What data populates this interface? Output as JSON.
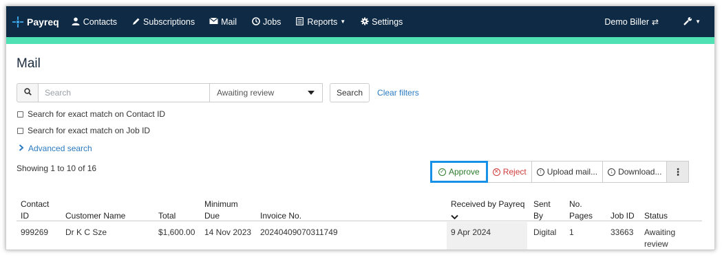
{
  "nav": {
    "brand": "Payreq",
    "items": [
      {
        "label": "Contacts",
        "icon": "user-icon"
      },
      {
        "label": "Subscriptions",
        "icon": "pencil-icon"
      },
      {
        "label": "Mail",
        "icon": "envelope-icon"
      },
      {
        "label": "Jobs",
        "icon": "clock-icon"
      },
      {
        "label": "Reports",
        "icon": "list-icon"
      },
      {
        "label": "Settings",
        "icon": "gear-icon"
      }
    ],
    "biller": "Demo Biller"
  },
  "colors": {
    "navbar": "#0e2a45",
    "accent": "#4fe0b3",
    "link": "#2a7ac0",
    "highlight": "#1791e8"
  },
  "page": {
    "title": "Mail"
  },
  "filters": {
    "search_placeholder": "Search",
    "status_selected": "Awaiting review",
    "search_button": "Search",
    "clear_filters": "Clear filters",
    "exact_contact": "Search for exact match on Contact ID",
    "exact_job": "Search for exact match on Job ID",
    "advanced_search": "Advanced search"
  },
  "summary": {
    "showing": "Showing 1 to 10 of 16"
  },
  "actions": {
    "approve": "Approve",
    "reject": "Reject",
    "upload": "Upload mail...",
    "download": "Download..."
  },
  "table": {
    "headers": {
      "contact_id": [
        "Contact",
        "ID"
      ],
      "customer_name": "Customer Name",
      "total": "Total",
      "minimum_due": [
        "Minimum",
        "Due"
      ],
      "invoice_no": "Invoice No.",
      "received_by": "Received by Payreq",
      "sent_by": [
        "Sent",
        "By"
      ],
      "no_pages": [
        "No.",
        "Pages"
      ],
      "job_id": "Job ID",
      "status": "Status"
    },
    "rows": [
      {
        "contact_id": "999269",
        "customer_name": "Dr K C Sze",
        "total": "$1,600.00",
        "minimum_due": "14 Nov 2023",
        "invoice_no": "20240409070311749",
        "received": "9 Apr 2024",
        "sent_by": "Digital",
        "no_pages": "1",
        "job_id": "33663",
        "status": [
          "Awaiting",
          "review"
        ]
      }
    ]
  }
}
